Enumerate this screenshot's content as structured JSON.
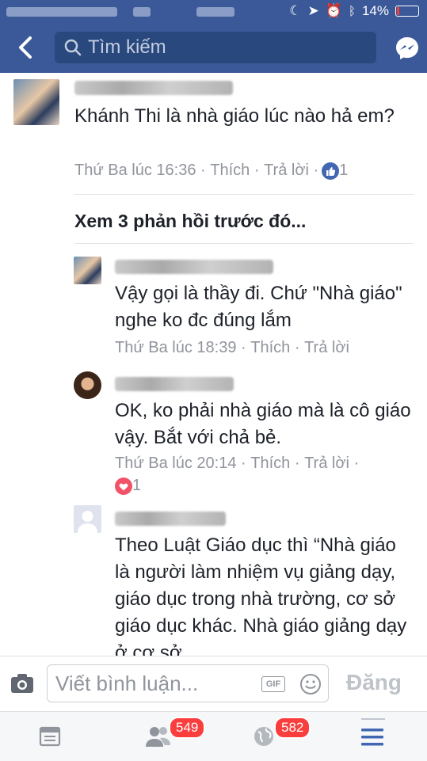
{
  "status_bar": {
    "battery": "14%",
    "battery_level": 0.14
  },
  "search": {
    "placeholder": "Tìm kiếm"
  },
  "comments": [
    {
      "text": "Khánh Thi là nhà giáo lúc nào hả em?",
      "time": "Thứ Ba lúc 16:36",
      "like": "Thích",
      "reply": "Trả lời",
      "reaction_count": "1"
    }
  ],
  "view_more": "Xem 3 phản hồi trước đó...",
  "replies": [
    {
      "text": "Vậy gọi là thầy đi. Chứ \"Nhà giáo\" nghe ko đc đúng lắm",
      "time": "Thứ Ba lúc 18:39",
      "like": "Thích",
      "reply": "Trả lời"
    },
    {
      "text": "OK, ko phải nhà giáo mà là cô giáo vậy. Bắt với chả bẻ.",
      "time": "Thứ Ba lúc 20:14",
      "like": "Thích",
      "reply": "Trả lời",
      "reaction_count": "1"
    },
    {
      "text": "Theo Luật Giáo dục thì “Nhà giáo là người làm nhiệm vụ giảng dạy, giáo dục trong nhà trường, cơ sở giáo dục khác. Nhà giáo giảng dạy ở cơ sở"
    }
  ],
  "composer": {
    "placeholder": "Viết bình luận...",
    "gif_label": "GIF",
    "post_label": "Đăng"
  },
  "tabs": {
    "friends_badge": "549",
    "notifications_badge": "582"
  },
  "colors": {
    "header": "#3b5998",
    "like_blue": "#4267b2",
    "love_red": "#f25268",
    "badge": "#fa3e3e"
  }
}
